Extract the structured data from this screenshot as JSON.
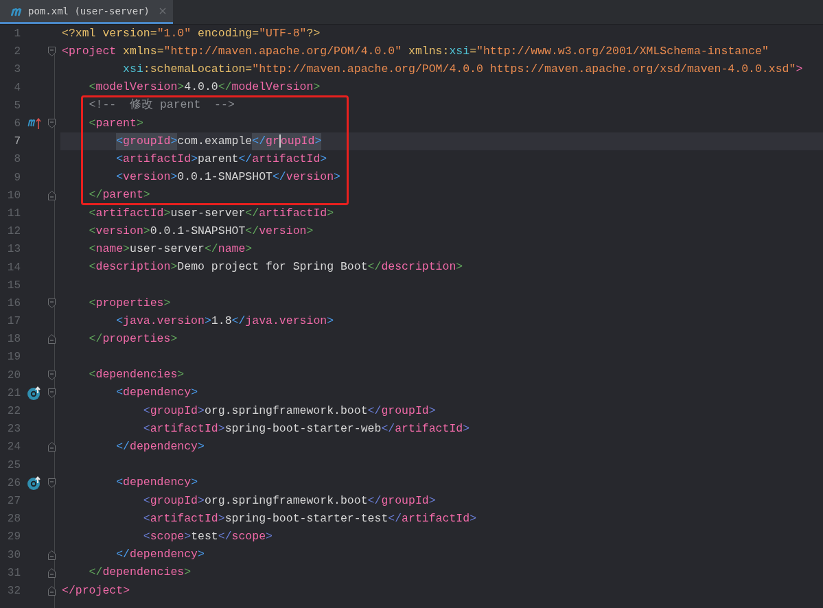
{
  "tabs": [
    {
      "label": "pom.xml (user-server)",
      "selected": true,
      "closable": true
    }
  ],
  "annotation": {
    "kind": "rectangle"
  },
  "lines": [
    {
      "number": "1",
      "current": false,
      "tokens": [
        {
          "kind": "decl",
          "text": "<?xml"
        },
        {
          "kind": "attr",
          "text": " version="
        },
        {
          "kind": "value",
          "text": "\"1.0\""
        },
        {
          "kind": "attr",
          "text": " encoding="
        },
        {
          "kind": "value",
          "text": "\"UTF-8\""
        },
        {
          "kind": "decl",
          "text": "?>"
        }
      ]
    },
    {
      "number": "2",
      "current": false,
      "fold": {
        "kind": "start"
      },
      "tokens": [
        {
          "kind": "bracket",
          "color": "#f06aa8",
          "text": "<"
        },
        {
          "kind": "tag",
          "text": "project"
        },
        {
          "kind": "attr",
          "text": " xmlns="
        },
        {
          "kind": "value",
          "text": "\"http://maven.apache.org/POM/4.0.0\""
        },
        {
          "kind": "attr",
          "text": " xmlns:"
        },
        {
          "kind": "ns",
          "text": "xsi"
        },
        {
          "kind": "attr",
          "text": "="
        },
        {
          "kind": "value",
          "text": "\"http://www.w3.org/2001/XMLSchema-instance\""
        }
      ],
      "children": [
        {
          "number": "3",
          "current": false,
          "kind": "continuation",
          "tokens": [
            {
              "kind": "ns",
              "text": "xsi"
            },
            {
              "kind": "attr",
              "text": ":schemaLocation="
            },
            {
              "kind": "value",
              "text": "\"http://maven.apache.org/POM/4.0.0 https://maven.apache.org/xsd/maven-4.0.0.xsd\""
            },
            {
              "kind": "bracket",
              "color": "#f06aa8",
              "text": ">"
            }
          ]
        },
        {
          "number": "4",
          "current": false,
          "tokens": [
            {
              "kind": "bracket",
              "color": "#62a85c",
              "text": "<"
            },
            {
              "kind": "tag",
              "text": "modelVersion"
            },
            {
              "kind": "bracket",
              "color": "#62a85c",
              "text": ">"
            },
            {
              "kind": "text",
              "text": "4.0.0"
            },
            {
              "kind": "bracket",
              "color": "#62a85c",
              "text": "</"
            },
            {
              "kind": "tag",
              "text": "modelVersion"
            },
            {
              "kind": "bracket",
              "color": "#62a85c",
              "text": ">"
            }
          ]
        },
        {
          "number": "5",
          "current": false,
          "tokens": [
            {
              "kind": "comment",
              "text": "<!--  修改 parent  -->"
            }
          ]
        },
        {
          "number": "6",
          "current": false,
          "fold": {
            "kind": "start"
          },
          "gutter_icon": {
            "kind": "maven-parent"
          },
          "tokens": [
            {
              "kind": "bracket",
              "color": "#62a85c",
              "text": "<"
            },
            {
              "kind": "tag",
              "text": "parent"
            },
            {
              "kind": "bracket",
              "color": "#62a85c",
              "text": ">"
            }
          ],
          "children": [
            {
              "number": "7",
              "current": true,
              "tokens": [
                {
                  "kind": "bracket",
                  "color": "#4b9ef0",
                  "text": "<",
                  "highlighted": true,
                  "caret_after": false
                },
                {
                  "kind": "tag",
                  "text": "groupId",
                  "highlighted": true,
                  "caret_after": false
                },
                {
                  "kind": "bracket",
                  "color": "#4b9ef0",
                  "text": ">",
                  "highlighted": true,
                  "caret_after": false
                },
                {
                  "kind": "text",
                  "text": "com.example",
                  "highlighted": false,
                  "caret_after": false
                },
                {
                  "kind": "bracket",
                  "color": "#4b9ef0",
                  "text": "</",
                  "highlighted": true,
                  "caret_after": false
                },
                {
                  "kind": "tag",
                  "text": "gr",
                  "highlighted": true,
                  "caret_after": true
                },
                {
                  "kind": "tag",
                  "text": "oupId",
                  "highlighted": true,
                  "caret_after": false
                },
                {
                  "kind": "bracket",
                  "color": "#4b9ef0",
                  "text": ">",
                  "highlighted": true,
                  "caret_after": false
                }
              ]
            },
            {
              "number": "8",
              "current": false,
              "tokens": [
                {
                  "kind": "bracket",
                  "color": "#4b9ef0",
                  "text": "<"
                },
                {
                  "kind": "tag",
                  "text": "artifactId"
                },
                {
                  "kind": "bracket",
                  "color": "#4b9ef0",
                  "text": ">"
                },
                {
                  "kind": "text",
                  "text": "parent"
                },
                {
                  "kind": "bracket",
                  "color": "#4b9ef0",
                  "text": "</"
                },
                {
                  "kind": "tag",
                  "text": "artifactId"
                },
                {
                  "kind": "bracket",
                  "color": "#4b9ef0",
                  "text": ">"
                }
              ]
            },
            {
              "number": "9",
              "current": false,
              "tokens": [
                {
                  "kind": "bracket",
                  "color": "#4b9ef0",
                  "text": "<"
                },
                {
                  "kind": "tag",
                  "text": "version"
                },
                {
                  "kind": "bracket",
                  "color": "#4b9ef0",
                  "text": ">"
                },
                {
                  "kind": "text",
                  "text": "0.0.1-SNAPSHOT"
                },
                {
                  "kind": "bracket",
                  "color": "#4b9ef0",
                  "text": "</"
                },
                {
                  "kind": "tag",
                  "text": "version"
                },
                {
                  "kind": "bracket",
                  "color": "#4b9ef0",
                  "text": ">"
                }
              ]
            }
          ]
        },
        {
          "number": "10",
          "current": false,
          "fold": {
            "kind": "end"
          },
          "tokens": [
            {
              "kind": "bracket",
              "color": "#62a85c",
              "text": "</"
            },
            {
              "kind": "tag",
              "text": "parent"
            },
            {
              "kind": "bracket",
              "color": "#62a85c",
              "text": ">"
            }
          ]
        },
        {
          "number": "11",
          "current": false,
          "tokens": [
            {
              "kind": "bracket",
              "color": "#62a85c",
              "text": "<"
            },
            {
              "kind": "tag",
              "text": "artifactId"
            },
            {
              "kind": "bracket",
              "color": "#62a85c",
              "text": ">"
            },
            {
              "kind": "text",
              "text": "user-server"
            },
            {
              "kind": "bracket",
              "color": "#62a85c",
              "text": "</"
            },
            {
              "kind": "tag",
              "text": "artifactId"
            },
            {
              "kind": "bracket",
              "color": "#62a85c",
              "text": ">"
            }
          ]
        },
        {
          "number": "12",
          "current": false,
          "tokens": [
            {
              "kind": "bracket",
              "color": "#62a85c",
              "text": "<"
            },
            {
              "kind": "tag",
              "text": "version"
            },
            {
              "kind": "bracket",
              "color": "#62a85c",
              "text": ">"
            },
            {
              "kind": "text",
              "text": "0.0.1-SNAPSHOT"
            },
            {
              "kind": "bracket",
              "color": "#62a85c",
              "text": "</"
            },
            {
              "kind": "tag",
              "text": "version"
            },
            {
              "kind": "bracket",
              "color": "#62a85c",
              "text": ">"
            }
          ]
        },
        {
          "number": "13",
          "current": false,
          "tokens": [
            {
              "kind": "bracket",
              "color": "#62a85c",
              "text": "<"
            },
            {
              "kind": "tag",
              "text": "name"
            },
            {
              "kind": "bracket",
              "color": "#62a85c",
              "text": ">"
            },
            {
              "kind": "text",
              "text": "user-server"
            },
            {
              "kind": "bracket",
              "color": "#62a85c",
              "text": "</"
            },
            {
              "kind": "tag",
              "text": "name"
            },
            {
              "kind": "bracket",
              "color": "#62a85c",
              "text": ">"
            }
          ]
        },
        {
          "number": "14",
          "current": false,
          "tokens": [
            {
              "kind": "bracket",
              "color": "#62a85c",
              "text": "<"
            },
            {
              "kind": "tag",
              "text": "description"
            },
            {
              "kind": "bracket",
              "color": "#62a85c",
              "text": ">"
            },
            {
              "kind": "text",
              "text": "Demo project for Spring Boot"
            },
            {
              "kind": "bracket",
              "color": "#62a85c",
              "text": "</"
            },
            {
              "kind": "tag",
              "text": "description"
            },
            {
              "kind": "bracket",
              "color": "#62a85c",
              "text": ">"
            }
          ]
        },
        {
          "number": "15",
          "current": false
        },
        {
          "number": "16",
          "current": false,
          "fold": {
            "kind": "start"
          },
          "tokens": [
            {
              "kind": "bracket",
              "color": "#62a85c",
              "text": "<"
            },
            {
              "kind": "tag",
              "text": "properties"
            },
            {
              "kind": "bracket",
              "color": "#62a85c",
              "text": ">"
            }
          ],
          "children": [
            {
              "number": "17",
              "current": false,
              "tokens": [
                {
                  "kind": "bracket",
                  "color": "#4b9ef0",
                  "text": "<"
                },
                {
                  "kind": "tag",
                  "text": "java.version"
                },
                {
                  "kind": "bracket",
                  "color": "#4b9ef0",
                  "text": ">"
                },
                {
                  "kind": "text",
                  "text": "1.8"
                },
                {
                  "kind": "bracket",
                  "color": "#4b9ef0",
                  "text": "</"
                },
                {
                  "kind": "tag",
                  "text": "java.version"
                },
                {
                  "kind": "bracket",
                  "color": "#4b9ef0",
                  "text": ">"
                }
              ]
            }
          ]
        },
        {
          "number": "18",
          "current": false,
          "fold": {
            "kind": "end"
          },
          "tokens": [
            {
              "kind": "bracket",
              "color": "#62a85c",
              "text": "</"
            },
            {
              "kind": "tag",
              "text": "properties"
            },
            {
              "kind": "bracket",
              "color": "#62a85c",
              "text": ">"
            }
          ]
        },
        {
          "number": "19",
          "current": false
        },
        {
          "number": "20",
          "current": false,
          "fold": {
            "kind": "start"
          },
          "tokens": [
            {
              "kind": "bracket",
              "color": "#62a85c",
              "text": "<"
            },
            {
              "kind": "tag",
              "text": "dependencies"
            },
            {
              "kind": "bracket",
              "color": "#62a85c",
              "text": ">"
            }
          ],
          "children": [
            {
              "number": "21",
              "current": false,
              "fold": {
                "kind": "start"
              },
              "gutter_icon": {
                "kind": "dependency"
              },
              "tokens": [
                {
                  "kind": "bracket",
                  "color": "#4b9ef0",
                  "text": "<"
                },
                {
                  "kind": "tag",
                  "text": "dependency"
                },
                {
                  "kind": "bracket",
                  "color": "#4b9ef0",
                  "text": ">"
                }
              ],
              "children": [
                {
                  "number": "22",
                  "current": false,
                  "tokens": [
                    {
                      "kind": "bracket",
                      "color": "#6b7fd9",
                      "text": "<"
                    },
                    {
                      "kind": "tag",
                      "text": "groupId"
                    },
                    {
                      "kind": "bracket",
                      "color": "#6b7fd9",
                      "text": ">"
                    },
                    {
                      "kind": "text",
                      "text": "org.springframework.boot"
                    },
                    {
                      "kind": "bracket",
                      "color": "#6b7fd9",
                      "text": "</"
                    },
                    {
                      "kind": "tag",
                      "text": "groupId"
                    },
                    {
                      "kind": "bracket",
                      "color": "#6b7fd9",
                      "text": ">"
                    }
                  ]
                },
                {
                  "number": "23",
                  "current": false,
                  "tokens": [
                    {
                      "kind": "bracket",
                      "color": "#6b7fd9",
                      "text": "<"
                    },
                    {
                      "kind": "tag",
                      "text": "artifactId"
                    },
                    {
                      "kind": "bracket",
                      "color": "#6b7fd9",
                      "text": ">"
                    },
                    {
                      "kind": "text",
                      "text": "spring-boot-starter-web"
                    },
                    {
                      "kind": "bracket",
                      "color": "#6b7fd9",
                      "text": "</"
                    },
                    {
                      "kind": "tag",
                      "text": "artifactId"
                    },
                    {
                      "kind": "bracket",
                      "color": "#6b7fd9",
                      "text": ">"
                    }
                  ]
                }
              ]
            },
            {
              "number": "24",
              "current": false,
              "fold": {
                "kind": "end"
              },
              "tokens": [
                {
                  "kind": "bracket",
                  "color": "#4b9ef0",
                  "text": "</"
                },
                {
                  "kind": "tag",
                  "text": "dependency"
                },
                {
                  "kind": "bracket",
                  "color": "#4b9ef0",
                  "text": ">"
                }
              ]
            },
            {
              "number": "25",
              "current": false
            },
            {
              "number": "26",
              "current": false,
              "fold": {
                "kind": "start"
              },
              "gutter_icon": {
                "kind": "dependency"
              },
              "tokens": [
                {
                  "kind": "bracket",
                  "color": "#4b9ef0",
                  "text": "<"
                },
                {
                  "kind": "tag",
                  "text": "dependency"
                },
                {
                  "kind": "bracket",
                  "color": "#4b9ef0",
                  "text": ">"
                }
              ],
              "children": [
                {
                  "number": "27",
                  "current": false,
                  "tokens": [
                    {
                      "kind": "bracket",
                      "color": "#6b7fd9",
                      "text": "<"
                    },
                    {
                      "kind": "tag",
                      "text": "groupId"
                    },
                    {
                      "kind": "bracket",
                      "color": "#6b7fd9",
                      "text": ">"
                    },
                    {
                      "kind": "text",
                      "text": "org.springframework.boot"
                    },
                    {
                      "kind": "bracket",
                      "color": "#6b7fd9",
                      "text": "</"
                    },
                    {
                      "kind": "tag",
                      "text": "groupId"
                    },
                    {
                      "kind": "bracket",
                      "color": "#6b7fd9",
                      "text": ">"
                    }
                  ]
                },
                {
                  "number": "28",
                  "current": false,
                  "tokens": [
                    {
                      "kind": "bracket",
                      "color": "#6b7fd9",
                      "text": "<"
                    },
                    {
                      "kind": "tag",
                      "text": "artifactId"
                    },
                    {
                      "kind": "bracket",
                      "color": "#6b7fd9",
                      "text": ">"
                    },
                    {
                      "kind": "text",
                      "text": "spring-boot-starter-test"
                    },
                    {
                      "kind": "bracket",
                      "color": "#6b7fd9",
                      "text": "</"
                    },
                    {
                      "kind": "tag",
                      "text": "artifactId"
                    },
                    {
                      "kind": "bracket",
                      "color": "#6b7fd9",
                      "text": ">"
                    }
                  ]
                },
                {
                  "number": "29",
                  "current": false,
                  "tokens": [
                    {
                      "kind": "bracket",
                      "color": "#6b7fd9",
                      "text": "<"
                    },
                    {
                      "kind": "tag",
                      "text": "scope"
                    },
                    {
                      "kind": "bracket",
                      "color": "#6b7fd9",
                      "text": ">"
                    },
                    {
                      "kind": "text",
                      "text": "test"
                    },
                    {
                      "kind": "bracket",
                      "color": "#6b7fd9",
                      "text": "</"
                    },
                    {
                      "kind": "tag",
                      "text": "scope"
                    },
                    {
                      "kind": "bracket",
                      "color": "#6b7fd9",
                      "text": ">"
                    }
                  ]
                }
              ]
            },
            {
              "number": "30",
              "current": false,
              "fold": {
                "kind": "end"
              },
              "tokens": [
                {
                  "kind": "bracket",
                  "color": "#4b9ef0",
                  "text": "</"
                },
                {
                  "kind": "tag",
                  "text": "dependency"
                },
                {
                  "kind": "bracket",
                  "color": "#4b9ef0",
                  "text": ">"
                }
              ]
            }
          ]
        },
        {
          "number": "31",
          "current": false,
          "fold": {
            "kind": "end"
          },
          "tokens": [
            {
              "kind": "bracket",
              "color": "#62a85c",
              "text": "</"
            },
            {
              "kind": "tag",
              "text": "dependencies"
            },
            {
              "kind": "bracket",
              "color": "#62a85c",
              "text": ">"
            }
          ]
        }
      ]
    },
    {
      "number": "32",
      "current": false,
      "fold": {
        "kind": "end"
      },
      "tokens": [
        {
          "kind": "bracket",
          "color": "#f06aa8",
          "text": "</"
        },
        {
          "kind": "tag",
          "text": "project"
        },
        {
          "kind": "bracket",
          "color": "#f06aa8",
          "text": ">"
        }
      ]
    }
  ]
}
